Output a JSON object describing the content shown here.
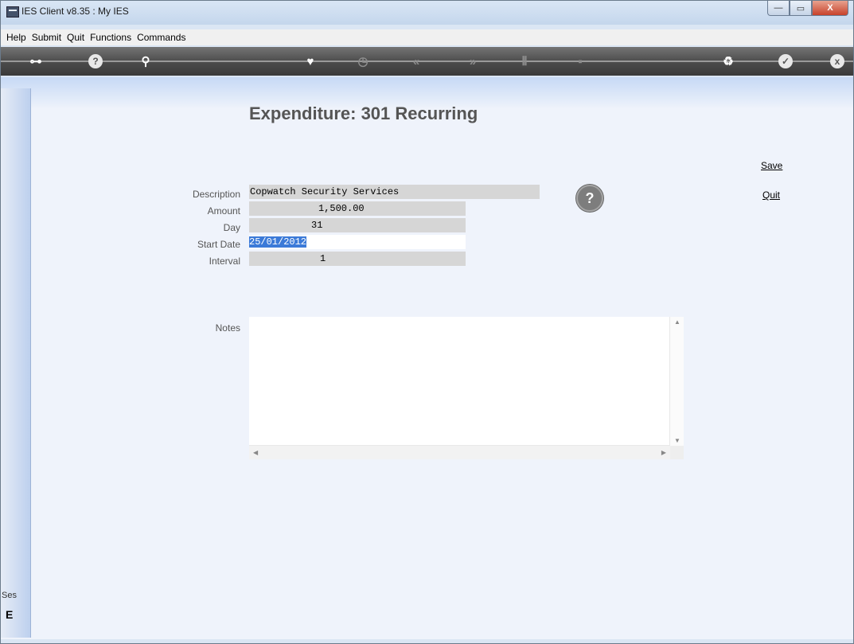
{
  "window": {
    "title": "IES Client v8.35 : My IES",
    "min": "—",
    "max": "▭",
    "close": "X"
  },
  "menu": [
    "Help",
    "Submit",
    "Quit",
    "Functions",
    "Commands"
  ],
  "toolbar": {
    "key": "⊶",
    "help": "?",
    "search": "⚲",
    "favourite": "♥",
    "history": "◷",
    "prev": "«",
    "next": "»",
    "tools": "⫴",
    "window": "▪",
    "recycle": "♻",
    "ok": "✓",
    "close": "x"
  },
  "form": {
    "heading": "Expenditure: 301 Recurring",
    "description_label": "Description",
    "description_value": "Copwatch Security Services",
    "amount_label": "Amount",
    "amount_value": "1,500.00",
    "day_label": "Day",
    "day_value": "31",
    "start_date_label": "Start Date",
    "start_date_value": "25/01/2012",
    "interval_label": "Interval",
    "interval_value": "1",
    "notes_label": "Notes",
    "notes_value": "",
    "help_icon": "?"
  },
  "actions": {
    "save": "Save",
    "quit": "Quit"
  },
  "left_panel": {
    "session_label": "Ses",
    "glyph": "E"
  }
}
